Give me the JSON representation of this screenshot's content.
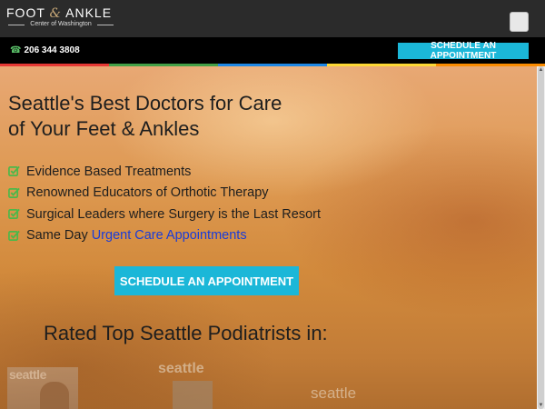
{
  "header": {
    "logo": {
      "line1_left": "FOOT",
      "line1_amp": "&",
      "line1_right": "ANKLE",
      "line2": "Center of Washington"
    },
    "menu_button": "menu-icon"
  },
  "contact": {
    "phone": "206 344 3808",
    "phone_icon": "phone-icon",
    "cta": "SCHEDULE AN APPOINTMENT"
  },
  "accent_colors": {
    "cta": "#1bb7d8",
    "check": "#4cb84a",
    "link": "#1a3cd8",
    "rainbow": [
      "#e53935",
      "#43a047",
      "#1e88e5",
      "#fdd835",
      "#fb8c00"
    ]
  },
  "hero": {
    "headline_line1": "Seattle's Best Doctors for Care",
    "headline_line2": "of Your Feet & Ankles",
    "bullets": [
      {
        "text": "Evidence Based Treatments"
      },
      {
        "text": "Renowned Educators of Orthotic Therapy"
      },
      {
        "text": "Surgical Leaders where Surgery is the Last Resort"
      },
      {
        "text": "Same Day",
        "link": "Urgent Care Appointments"
      }
    ],
    "cta": "SCHEDULE AN APPOINTMENT",
    "rated_heading": "Rated Top Seattle Podiatrists in:",
    "badges": [
      "seattle",
      "seattle",
      "seattle"
    ]
  }
}
